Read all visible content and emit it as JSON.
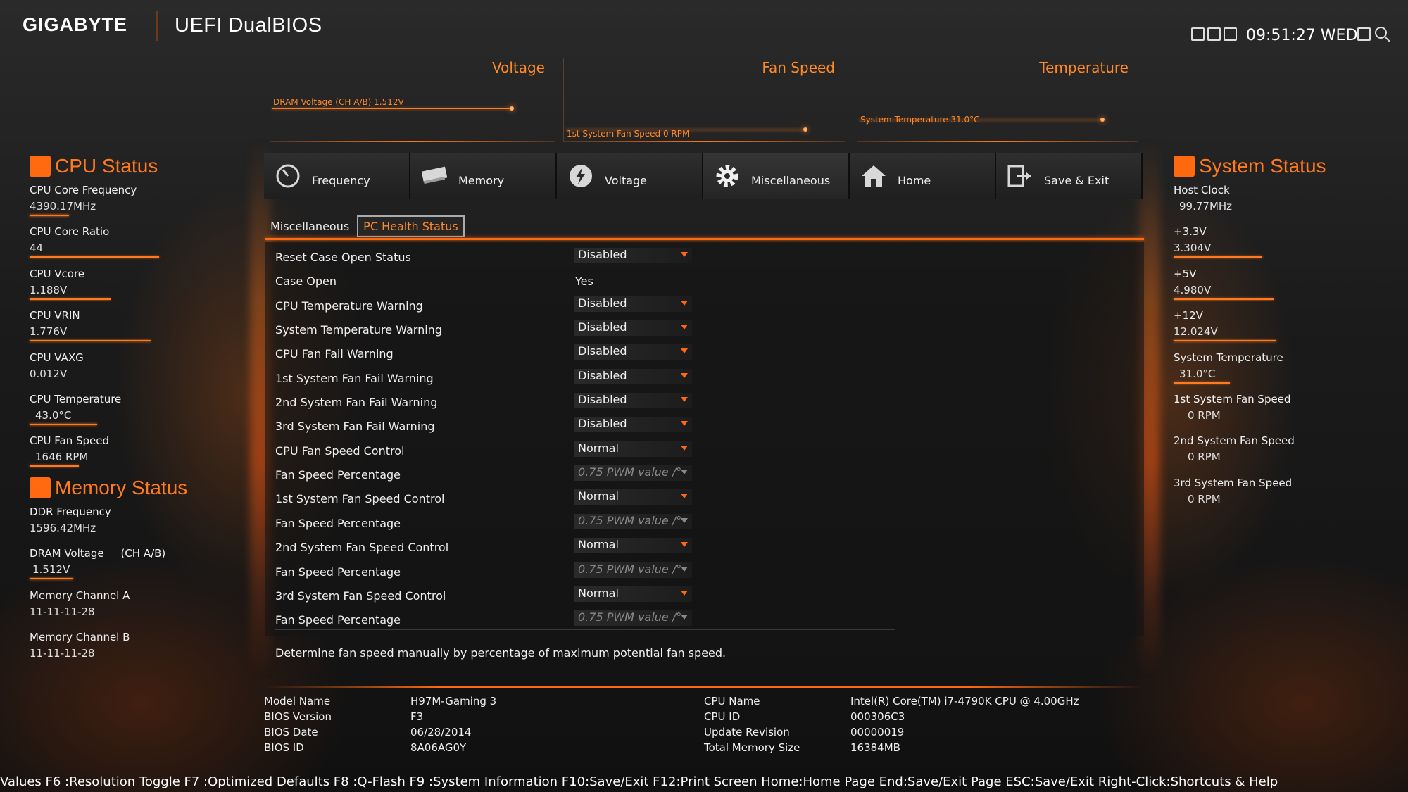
{
  "header": {
    "brand": "GIGABYTE",
    "product": "UEFI DualBIOS",
    "clock": "09:51:27 WED"
  },
  "monitors": {
    "voltage": {
      "title": "Voltage",
      "label": "DRAM Voltage    (CH A/B)     1.512V"
    },
    "fan": {
      "title": "Fan Speed",
      "label": "1st System Fan Speed            0 RPM"
    },
    "temperature": {
      "title": "Temperature",
      "label": "System Temperature      31.0°C"
    }
  },
  "cpu_status": {
    "title": "CPU Status",
    "items": [
      {
        "label": "CPU Core Frequency",
        "value": "4390.17MHz"
      },
      {
        "label": "CPU Core Ratio",
        "value": "44"
      },
      {
        "label": "CPU Vcore",
        "value": "1.188V"
      },
      {
        "label": "CPU VRIN",
        "value": "1.776V"
      },
      {
        "label": "CPU VAXG",
        "value": "0.012V"
      },
      {
        "label": "CPU Temperature",
        "value": "43.0°C"
      },
      {
        "label": "CPU Fan Speed",
        "value": "1646 RPM"
      }
    ]
  },
  "memory_status": {
    "title": "Memory Status",
    "items": [
      {
        "label": "DDR Frequency",
        "value": "1596.42MHz"
      },
      {
        "label": "DRAM Voltage     (CH A/B)",
        "value": "1.512V"
      },
      {
        "label": "Memory Channel A",
        "value": "11-11-11-28"
      },
      {
        "label": "Memory Channel B",
        "value": "11-11-11-28"
      }
    ]
  },
  "system_status": {
    "title": "System Status",
    "items": [
      {
        "label": "Host Clock",
        "value": "99.77MHz"
      },
      {
        "label": "+3.3V",
        "value": "3.304V"
      },
      {
        "label": "+5V",
        "value": "4.980V"
      },
      {
        "label": "+12V",
        "value": "12.024V"
      },
      {
        "label": "System Temperature",
        "value": "31.0°C"
      },
      {
        "label": "1st System Fan Speed",
        "value": "0 RPM"
      },
      {
        "label": "2nd System Fan Speed",
        "value": "0 RPM"
      },
      {
        "label": "3rd System Fan Speed",
        "value": "0 RPM"
      }
    ]
  },
  "nav": [
    {
      "label": "Frequency",
      "icon": "frequency-gauge-icon"
    },
    {
      "label": "Memory",
      "icon": "memory-module-icon"
    },
    {
      "label": "Voltage",
      "icon": "voltage-bolt-icon"
    },
    {
      "label": "Miscellaneous",
      "icon": "gear-icon"
    },
    {
      "label": "Home",
      "icon": "home-icon"
    },
    {
      "label": "Save & Exit",
      "icon": "exit-icon"
    }
  ],
  "subtabs": [
    "Miscellaneous",
    "PC Health Status"
  ],
  "settings": [
    {
      "label": "Reset Case Open Status",
      "value": "Disabled"
    },
    {
      "label": "Case Open",
      "value": "Yes"
    },
    {
      "label": "CPU Temperature Warning",
      "value": "Disabled"
    },
    {
      "label": "System Temperature Warning",
      "value": "Disabled"
    },
    {
      "label": "CPU Fan Fail Warning",
      "value": "Disabled"
    },
    {
      "label": "1st System Fan Fail Warning",
      "value": "Disabled"
    },
    {
      "label": "2nd System Fan Fail Warning",
      "value": "Disabled"
    },
    {
      "label": "3rd System Fan Fail Warning",
      "value": "Disabled"
    },
    {
      "label": "CPU Fan Speed Control",
      "value": "Normal"
    },
    {
      "label": "Fan Speed Percentage",
      "value": "0.75 PWM value /°"
    },
    {
      "label": "1st System Fan Speed Control",
      "value": "Normal"
    },
    {
      "label": "Fan Speed Percentage",
      "value": "0.75 PWM value /°"
    },
    {
      "label": "2nd System Fan Speed Control",
      "value": "Normal"
    },
    {
      "label": "Fan Speed Percentage",
      "value": "0.75 PWM value /°"
    },
    {
      "label": "3rd System Fan Speed Control",
      "value": "Normal"
    },
    {
      "label": "Fan Speed Percentage",
      "value": "0.75 PWM value /°"
    }
  ],
  "help_text": "Determine fan speed manually by percentage of maximum potential fan speed.",
  "system_info": {
    "left": [
      {
        "label": "Model Name",
        "value": "H97M-Gaming 3"
      },
      {
        "label": "BIOS Version",
        "value": "F3"
      },
      {
        "label": "BIOS Date",
        "value": "06/28/2014"
      },
      {
        "label": "BIOS ID",
        "value": "8A06AG0Y"
      }
    ],
    "right": [
      {
        "label": "CPU Name",
        "value": "Intel(R) Core(TM) i7-4790K CPU @ 4.00GHz"
      },
      {
        "label": "CPU ID",
        "value": "000306C3"
      },
      {
        "label": "Update Revision",
        "value": "00000019"
      },
      {
        "label": "Total Memory Size",
        "value": "16384MB"
      }
    ]
  },
  "footer": "Values F6 :Resolution Toggle F7 :Optimized Defaults F8 :Q-Flash F9 :System Information F10:Save/Exit F12:Print Screen Home:Home Page End:Save/Exit Page ESC:Save/Exit Right-Click:Shortcuts & Help",
  "colors": {
    "accent": "#ff6a10",
    "text": "#f0f0f0",
    "background": "#1a1a1a"
  }
}
